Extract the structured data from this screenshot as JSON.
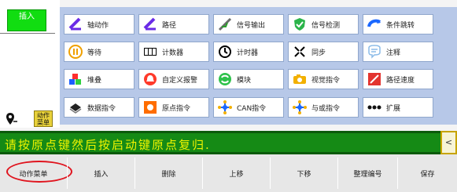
{
  "sidebar": {
    "insert_tab": "插入",
    "action_menu_tab": "动作\n菜单"
  },
  "commands": [
    {
      "label": "轴动作",
      "icon": "axis-motion-icon"
    },
    {
      "label": "路径",
      "icon": "path-icon"
    },
    {
      "label": "信号输出",
      "icon": "signal-output-icon"
    },
    {
      "label": "信号检测",
      "icon": "signal-detect-icon"
    },
    {
      "label": "条件跳转",
      "icon": "conditional-jump-icon"
    },
    {
      "label": "等待",
      "icon": "wait-icon"
    },
    {
      "label": "计数器",
      "icon": "counter-icon"
    },
    {
      "label": "计时器",
      "icon": "timer-icon"
    },
    {
      "label": "同步",
      "icon": "sync-icon"
    },
    {
      "label": "注释",
      "icon": "comment-icon"
    },
    {
      "label": "堆叠",
      "icon": "stack-icon"
    },
    {
      "label": "自定义报警",
      "icon": "custom-alarm-icon"
    },
    {
      "label": "模块",
      "icon": "module-icon"
    },
    {
      "label": "视觉指令",
      "icon": "vision-command-icon"
    },
    {
      "label": "路径速度",
      "icon": "path-speed-icon"
    },
    {
      "label": "数据指令",
      "icon": "data-command-icon"
    },
    {
      "label": "原点指令",
      "icon": "origin-command-icon"
    },
    {
      "label": "CAN指令",
      "icon": "can-command-icon"
    },
    {
      "label": "与或指令",
      "icon": "andor-command-icon"
    },
    {
      "label": "扩展",
      "icon": "extend-icon"
    }
  ],
  "message": "请按原点键然后按启动键原点复归.",
  "message_arrow": "<",
  "toolbar": {
    "buttons": [
      "动作菜单",
      "插入",
      "删除",
      "上移",
      "下移",
      "整理编号",
      "保存"
    ]
  },
  "colors": {
    "accent_green": "#158a15",
    "message_text": "#f0f400",
    "highlight": "#e0141e"
  }
}
